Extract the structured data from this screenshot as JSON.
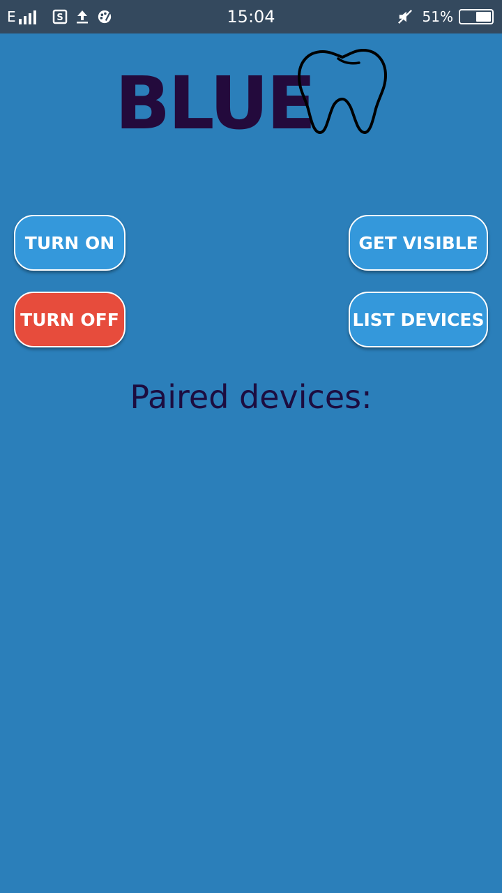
{
  "status_bar": {
    "network_type": "E",
    "time": "15:04",
    "battery_percent": "51%",
    "battery_level": 0.51,
    "icons": [
      "signal-icon",
      "sim-icon",
      "upload-icon",
      "palette-icon",
      "mute-icon",
      "battery-icon"
    ]
  },
  "logo": {
    "text": "BLUE",
    "icon": "tooth-icon",
    "text_color": "#230a3c"
  },
  "buttons": {
    "turn_on": "TURN ON",
    "turn_off": "TURN OFF",
    "get_visible": "GET VISIBLE",
    "list_devices": "LIST DEVICES"
  },
  "paired_label": "Paired devices:",
  "paired_devices": [],
  "colors": {
    "background": "#2b7fba",
    "status_bar": "#34495e",
    "button_blue": "#3498db",
    "button_red": "#e74c3c",
    "label_text": "#1c0d40"
  }
}
